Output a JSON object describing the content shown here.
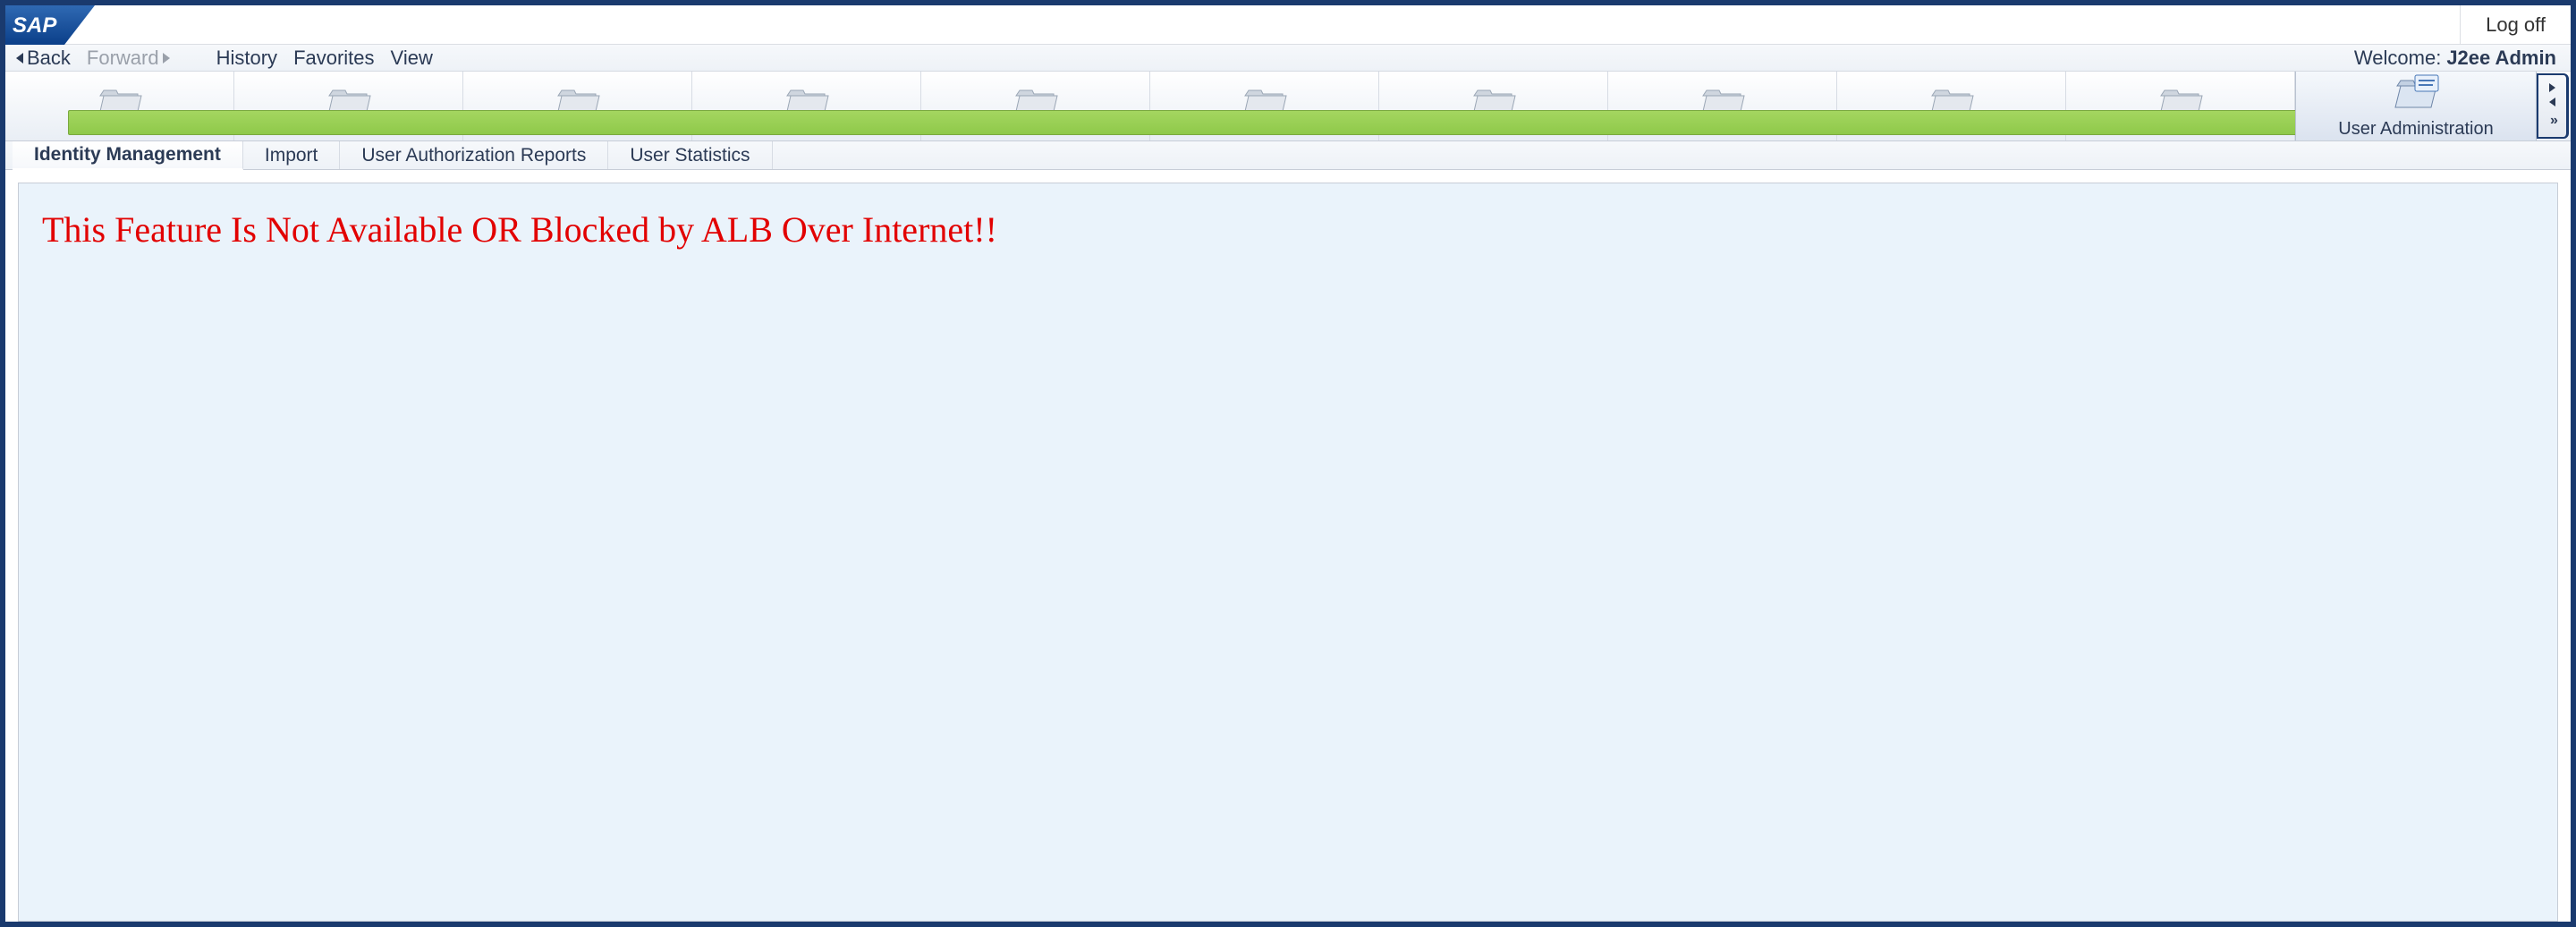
{
  "header": {
    "logoff_label": "Log off"
  },
  "nav": {
    "back_label": "Back",
    "forward_label": "Forward",
    "history_label": "History",
    "favorites_label": "Favorites",
    "view_label": "View",
    "welcome_label": "Welcome:",
    "welcome_user": "J2ee Admin"
  },
  "top_tabs": {
    "active_label": "User Administration",
    "inactive_count": 10
  },
  "sub_tabs": {
    "items": [
      {
        "label": "Identity Management",
        "active": true
      },
      {
        "label": "Import",
        "active": false
      },
      {
        "label": "User Authorization Reports",
        "active": false
      },
      {
        "label": "User Statistics",
        "active": false
      }
    ]
  },
  "content": {
    "error_message": "This Feature Is Not Available OR Blocked by ALB Over Internet!!"
  }
}
